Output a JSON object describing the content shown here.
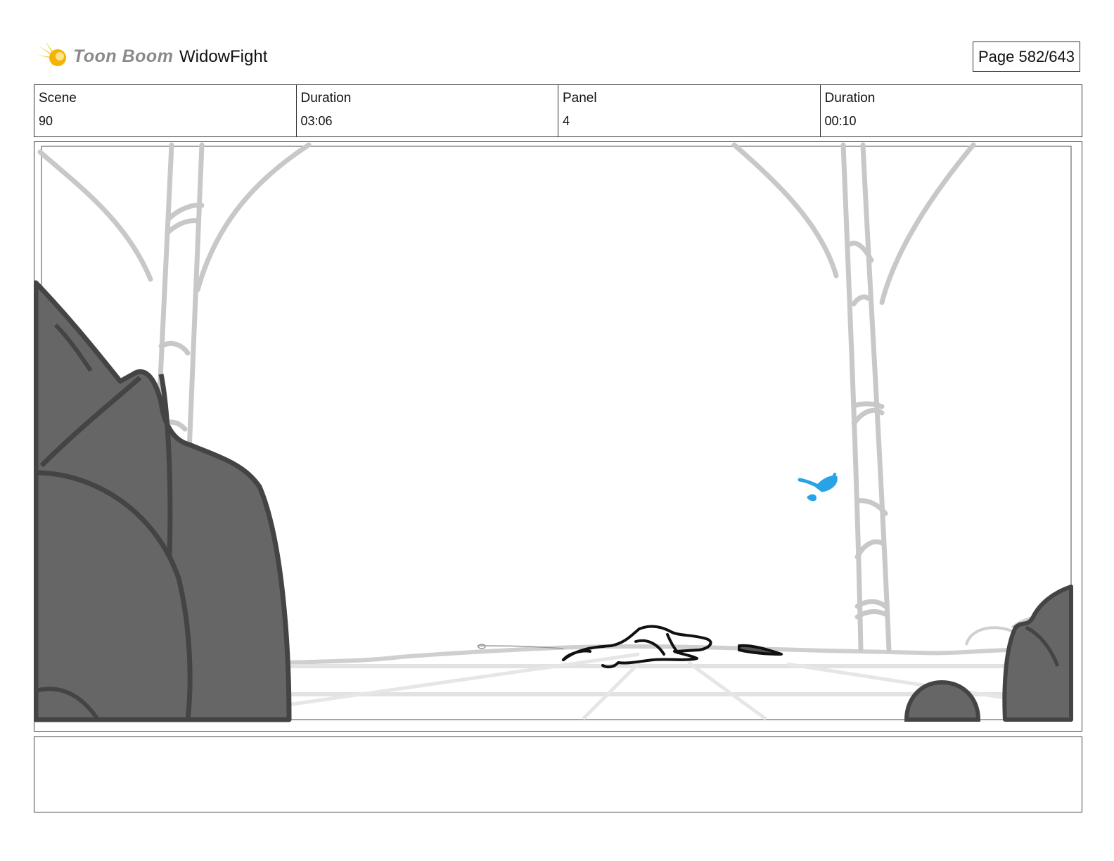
{
  "header": {
    "logo_text": "Toon Boom",
    "project_title": "WidowFight",
    "page_label": "Page 582/643"
  },
  "info": {
    "scene_label": "Scene",
    "scene_value": "90",
    "scene_duration_label": "Duration",
    "scene_duration_value": "03:06",
    "panel_label": "Panel",
    "panel_value": "4",
    "panel_duration_label": "Duration",
    "panel_duration_value": "00:10"
  },
  "notes": {
    "text": ""
  },
  "colors": {
    "rock": "#666666",
    "rock_outline": "#444444",
    "tree": "#c8c8c8",
    "bird": "#29a3e8",
    "logo_star": "#f2b705"
  }
}
